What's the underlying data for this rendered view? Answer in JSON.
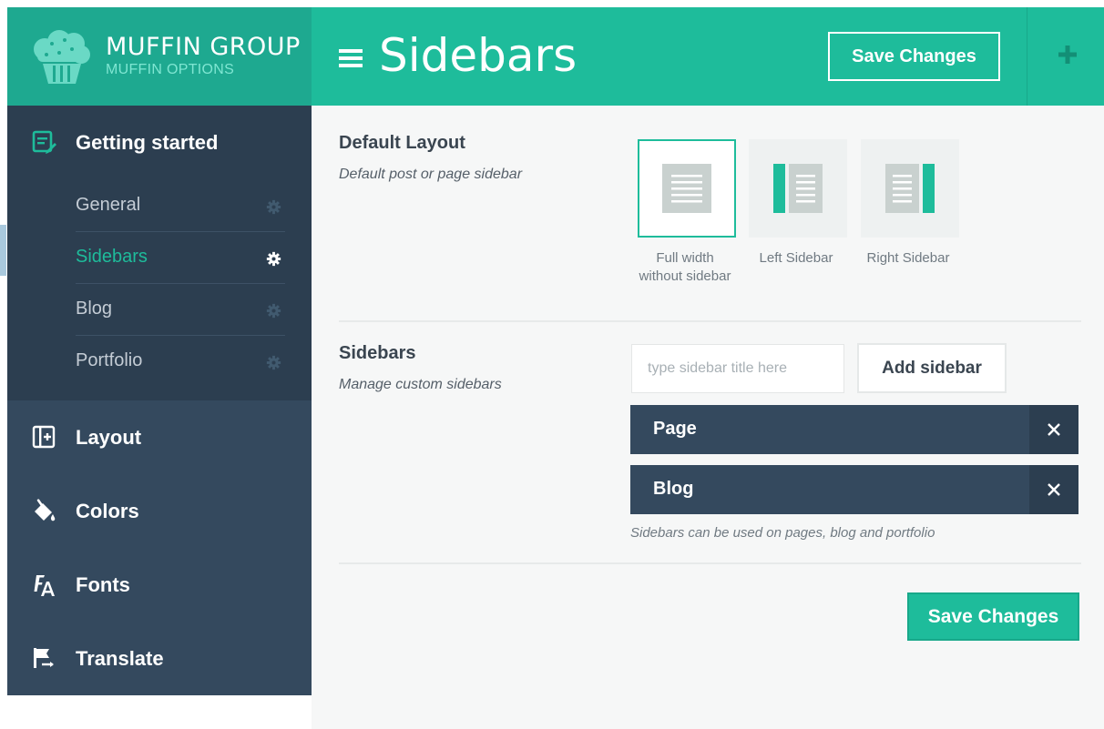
{
  "brand": {
    "name": "MUFFIN GROUP",
    "subtitle": "MUFFIN OPTIONS"
  },
  "sidebar": {
    "getting_started": {
      "label": "Getting started",
      "icon": "edit-icon",
      "items": [
        {
          "label": "General",
          "active": false
        },
        {
          "label": "Sidebars",
          "active": true
        },
        {
          "label": "Blog",
          "active": false
        },
        {
          "label": "Portfolio",
          "active": false
        }
      ]
    },
    "items": [
      {
        "label": "Layout",
        "icon": "layout-icon"
      },
      {
        "label": "Colors",
        "icon": "paint-bucket-icon"
      },
      {
        "label": "Fonts",
        "icon": "font-icon"
      },
      {
        "label": "Translate",
        "icon": "flag-icon"
      }
    ]
  },
  "header": {
    "title": "Sidebars",
    "save_label": "Save Changes"
  },
  "default_layout": {
    "title": "Default Layout",
    "description": "Default post or page sidebar",
    "options": [
      {
        "line1": "Full width",
        "line2": "without sidebar",
        "selected": true
      },
      {
        "line1": "Left Sidebar",
        "line2": "",
        "selected": false
      },
      {
        "line1": "Right Sidebar",
        "line2": "",
        "selected": false
      }
    ]
  },
  "sidebars_section": {
    "title": "Sidebars",
    "description": "Manage custom sidebars",
    "input_placeholder": "type sidebar title here",
    "add_label": "Add sidebar",
    "list": [
      {
        "name": "Page"
      },
      {
        "name": "Blog"
      }
    ],
    "note": "Sidebars can be used on pages, blog and portfolio"
  },
  "footer": {
    "save_label": "Save Changes"
  },
  "colors": {
    "accent": "#1ebc9b",
    "brand_bg": "#1ea990",
    "sidebar_bg": "#34495e",
    "sidebar_dark": "#2c3e50",
    "content_bg": "#f6f7f7"
  }
}
